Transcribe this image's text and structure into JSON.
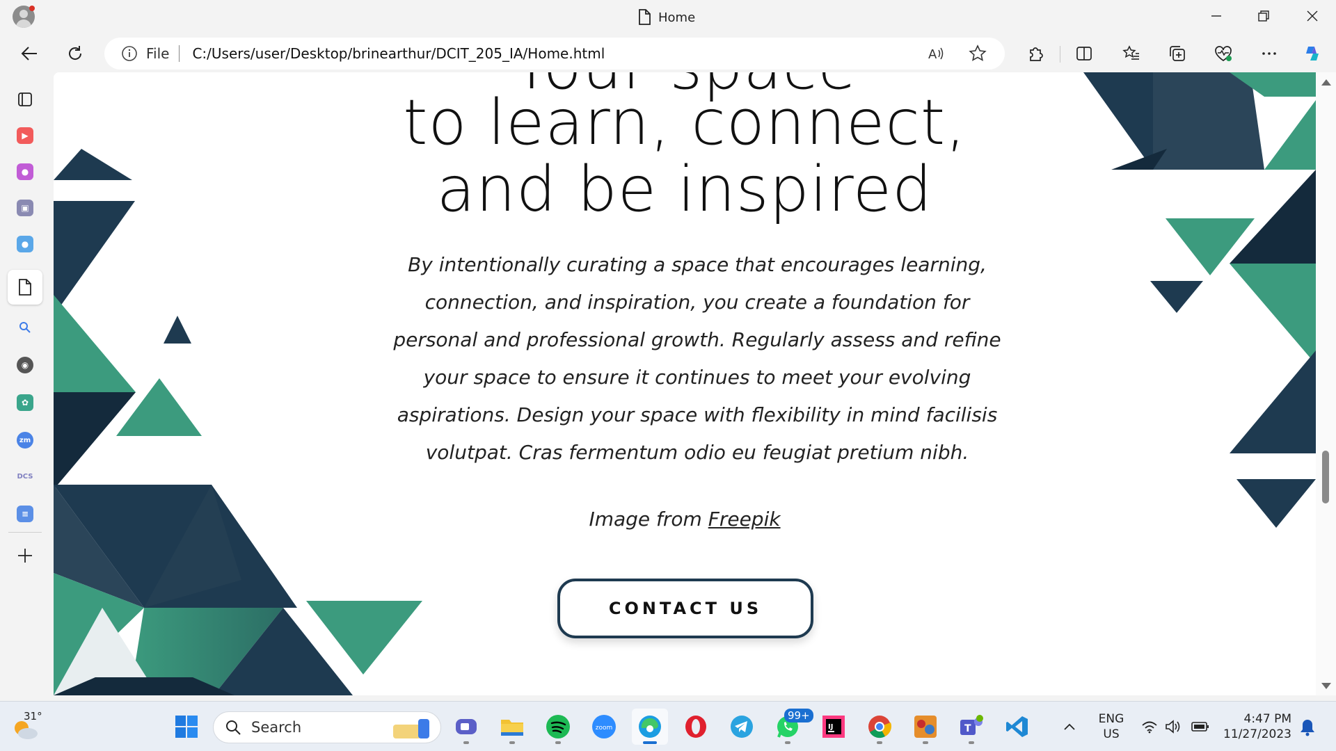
{
  "window": {
    "tab_title": "Home",
    "minimize": "minimize",
    "restore": "restore",
    "close": "close"
  },
  "toolbar": {
    "back_icon": "back-arrow-icon",
    "refresh_icon": "refresh-icon",
    "address": {
      "scheme_label": "File",
      "url": "C:/Users/user/Desktop/brinearthur/DCIT_205_IA/Home.html"
    },
    "actions": [
      "read-aloud-icon",
      "favorite-star-icon",
      "extensions-icon",
      "split-screen-icon",
      "favorites-icon",
      "collections-icon",
      "browser-essentials-icon",
      "more-icon",
      "copilot-icon"
    ]
  },
  "sidebar": {
    "items": [
      "tab-actions",
      "youtube",
      "games",
      "app",
      "contacts",
      "page",
      "search",
      "github",
      "chatgpt",
      "zoom",
      "dcs",
      "notes"
    ],
    "add_label": "+"
  },
  "page": {
    "heading_partial": "Your space",
    "heading_line1": "to learn, connect,",
    "heading_line2": "and be inspired",
    "intro": "By intentionally curating a space that encourages learning, connection, and inspiration, you create a foundation for personal and professional growth. Regularly assess and refine your space to ensure it continues to meet your evolving aspirations. Design your space with flexibility in mind facilisis volutpat. Cras fermentum odio eu feugiat pretium nibh.",
    "credit_prefix": "Image from",
    "credit_link": "Freepik",
    "contact_button": "CONTACT US",
    "colors": {
      "navy": "#1e3a50",
      "dark_navy": "#142a3c",
      "green": "#3c9b7e",
      "text": "#111111"
    }
  },
  "taskbar": {
    "weather": {
      "temp": "31°"
    },
    "search_placeholder": "Search",
    "apps": [
      "start",
      "search",
      "meet",
      "file-explorer",
      "spotify",
      "zoom",
      "edge",
      "opera",
      "telegram",
      "whatsapp",
      "intellij",
      "chrome",
      "game",
      "teams",
      "vscode"
    ],
    "whatsapp_badge": "99+",
    "language": {
      "line1": "ENG",
      "line2": "US"
    },
    "clock": {
      "time": "4:47 PM",
      "date": "11/27/2023"
    }
  }
}
